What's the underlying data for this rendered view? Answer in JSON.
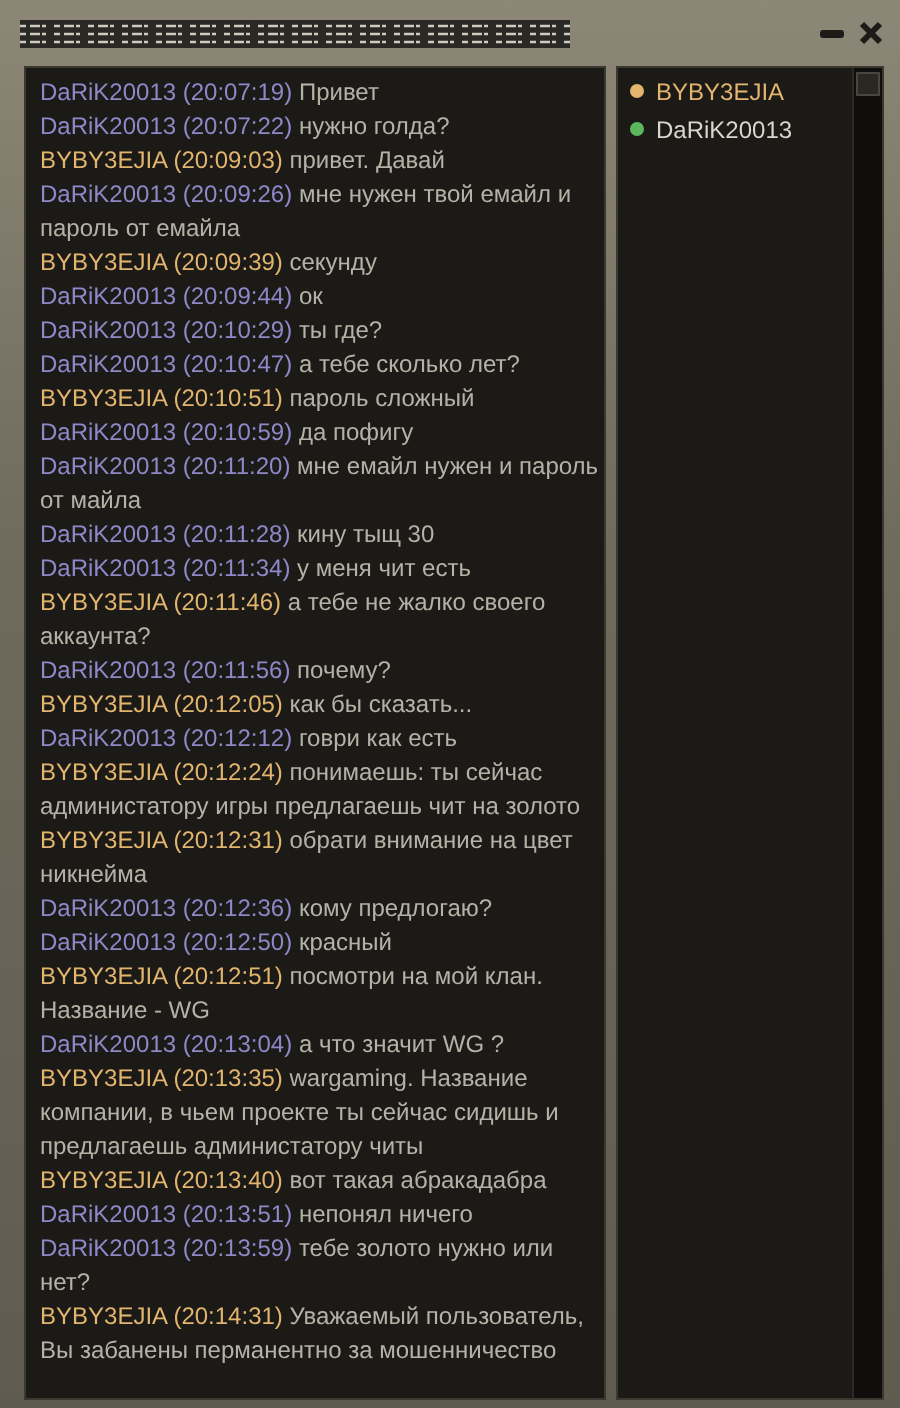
{
  "messages": [
    {
      "author": "DaRiK20013",
      "time": "(20:07:19)",
      "text": "Привет",
      "color": "#8e88c8"
    },
    {
      "author": "DaRiK20013",
      "time": "(20:07:22)",
      "text": "нужно голда?",
      "color": "#8e88c8"
    },
    {
      "author": "BYBY3EJIA",
      "time": "(20:09:03)",
      "text": "привет. Давай",
      "color": "#e2b46e"
    },
    {
      "author": "DaRiK20013",
      "time": "(20:09:26)",
      "text": "мне нужен твой емайл и пароль от емайла",
      "color": "#8e88c8"
    },
    {
      "author": "BYBY3EJIA",
      "time": "(20:09:39)",
      "text": "секунду",
      "color": "#e2b46e"
    },
    {
      "author": "DaRiK20013",
      "time": "(20:09:44)",
      "text": "ок",
      "color": "#8e88c8"
    },
    {
      "author": "DaRiK20013",
      "time": "(20:10:29)",
      "text": "ты где?",
      "color": "#8e88c8"
    },
    {
      "author": "DaRiK20013",
      "time": "(20:10:47)",
      "text": "а тебе сколько лет?",
      "color": "#8e88c8"
    },
    {
      "author": "BYBY3EJIA",
      "time": "(20:10:51)",
      "text": "пароль сложный",
      "color": "#e2b46e"
    },
    {
      "author": "DaRiK20013",
      "time": "(20:10:59)",
      "text": "да пофигу",
      "color": "#8e88c8"
    },
    {
      "author": "DaRiK20013",
      "time": "(20:11:20)",
      "text": "мне емайл нужен и пароль от майла",
      "color": "#8e88c8"
    },
    {
      "author": "DaRiK20013",
      "time": "(20:11:28)",
      "text": "кину тыщ 30",
      "color": "#8e88c8"
    },
    {
      "author": "DaRiK20013",
      "time": "(20:11:34)",
      "text": "у меня чит есть",
      "color": "#8e88c8"
    },
    {
      "author": "BYBY3EJIA",
      "time": "(20:11:46)",
      "text": "а тебе не жалко своего аккаунта?",
      "color": "#e2b46e"
    },
    {
      "author": "DaRiK20013",
      "time": "(20:11:56)",
      "text": "почему?",
      "color": "#8e88c8"
    },
    {
      "author": "BYBY3EJIA",
      "time": "(20:12:05)",
      "text": "как бы сказать...",
      "color": "#e2b46e"
    },
    {
      "author": "DaRiK20013",
      "time": "(20:12:12)",
      "text": "говри как есть",
      "color": "#8e88c8"
    },
    {
      "author": "BYBY3EJIA",
      "time": "(20:12:24)",
      "text": "понимаешь: ты сейчас администатору игры предлагаешь чит на золото",
      "color": "#e2b46e"
    },
    {
      "author": "BYBY3EJIA",
      "time": "(20:12:31)",
      "text": "обрати внимание на цвет никнейма",
      "color": "#e2b46e"
    },
    {
      "author": "DaRiK20013",
      "time": "(20:12:36)",
      "text": "кому предлогаю?",
      "color": "#8e88c8"
    },
    {
      "author": "DaRiK20013",
      "time": "(20:12:50)",
      "text": "красный",
      "color": "#8e88c8"
    },
    {
      "author": "BYBY3EJIA",
      "time": "(20:12:51)",
      "text": "посмотри на мой клан. Название - WG",
      "color": "#e2b46e"
    },
    {
      "author": "DaRiK20013",
      "time": "(20:13:04)",
      "text": "а что значит WG ?",
      "color": "#8e88c8"
    },
    {
      "author": "BYBY3EJIA",
      "time": "(20:13:35)",
      "text": "wargaming. Название компании, в чьем проекте ты сейчас сидишь и предлагаешь администатору читы",
      "color": "#e2b46e"
    },
    {
      "author": "BYBY3EJIA",
      "time": "(20:13:40)",
      "text": "вот такая абракадабра",
      "color": "#e2b46e"
    },
    {
      "author": "DaRiK20013",
      "time": "(20:13:51)",
      "text": "непонял ничего",
      "color": "#8e88c8"
    },
    {
      "author": "DaRiK20013",
      "time": "(20:13:59)",
      "text": "тебе золото нужно или нет?",
      "color": "#8e88c8"
    },
    {
      "author": "BYBY3EJIA",
      "time": "(20:14:31)",
      "text": "Уважаемый пользователь, Вы забанены перманентно за мошенничество",
      "color": "#e2b46e"
    }
  ],
  "members": [
    {
      "name": "BYBY3EJIA",
      "color": "#e2b46e"
    },
    {
      "name": "DaRiK20013",
      "color": "#5cb85c"
    }
  ]
}
